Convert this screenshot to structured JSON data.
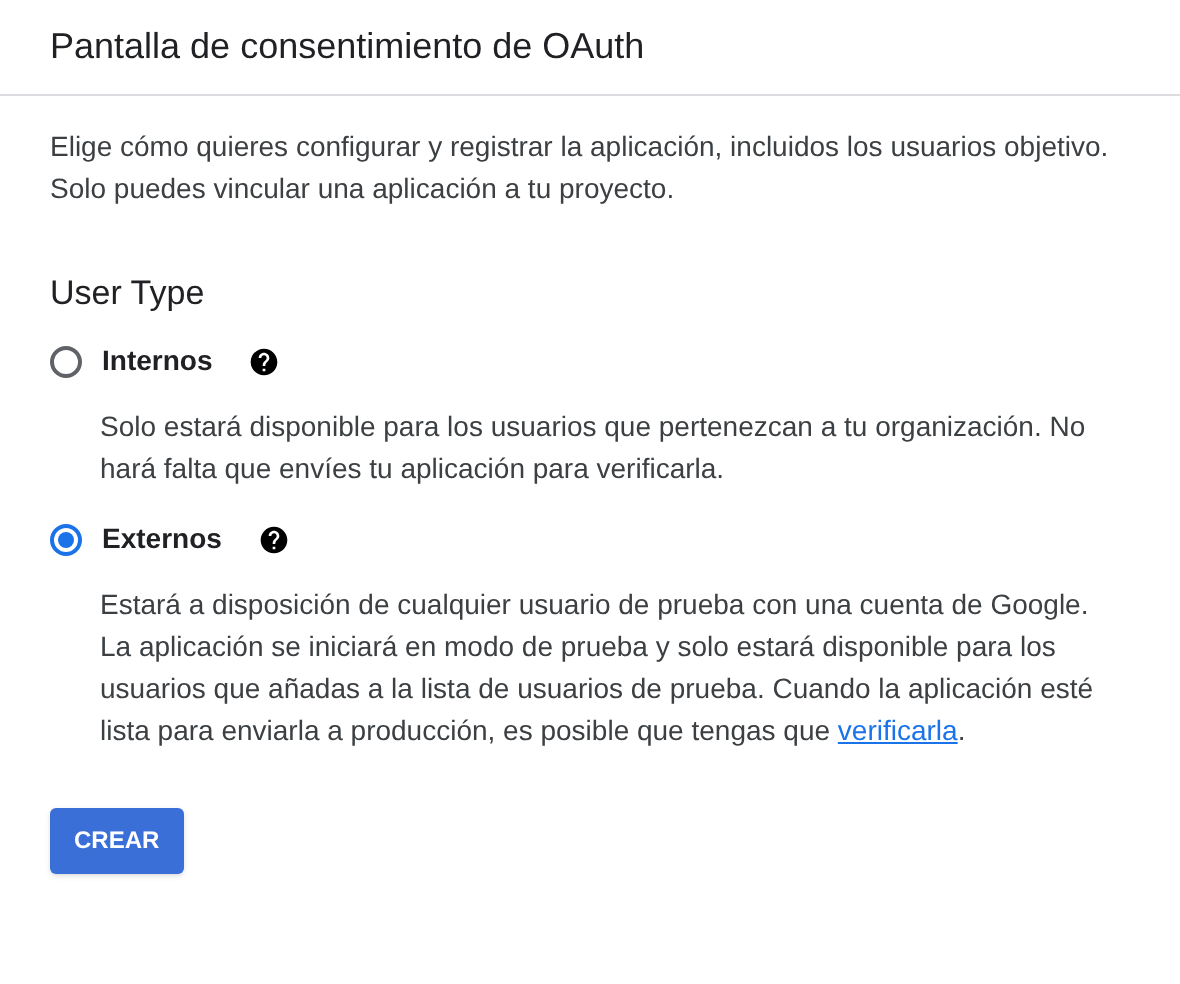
{
  "header": {
    "title": "Pantalla de consentimiento de OAuth"
  },
  "intro": "Elige cómo quieres configurar y registrar la aplicación, incluidos los usuarios objetivo. Solo puedes vincular una aplicación a tu proyecto.",
  "user_type": {
    "heading": "User Type",
    "options": [
      {
        "label": "Internos",
        "selected": false,
        "description": [
          {
            "kind": "text",
            "text": "Solo estará disponible para los usuarios que pertenezcan a tu organización. No hará falta que envíes tu aplicación para verificarla."
          }
        ]
      },
      {
        "label": "Externos",
        "selected": true,
        "description": [
          {
            "kind": "text",
            "text": "Estará a disposición de cualquier usuario de prueba con una cuenta de Google. La aplicación se iniciará en modo de prueba y solo estará disponible para los usuarios que añadas a la lista de usuarios de prueba. Cuando la aplicación esté lista para enviarla a producción, es posible que tengas que "
          },
          {
            "kind": "link",
            "text": "verificarla"
          },
          {
            "kind": "text",
            "text": "."
          }
        ]
      }
    ]
  },
  "button": "CREAR"
}
